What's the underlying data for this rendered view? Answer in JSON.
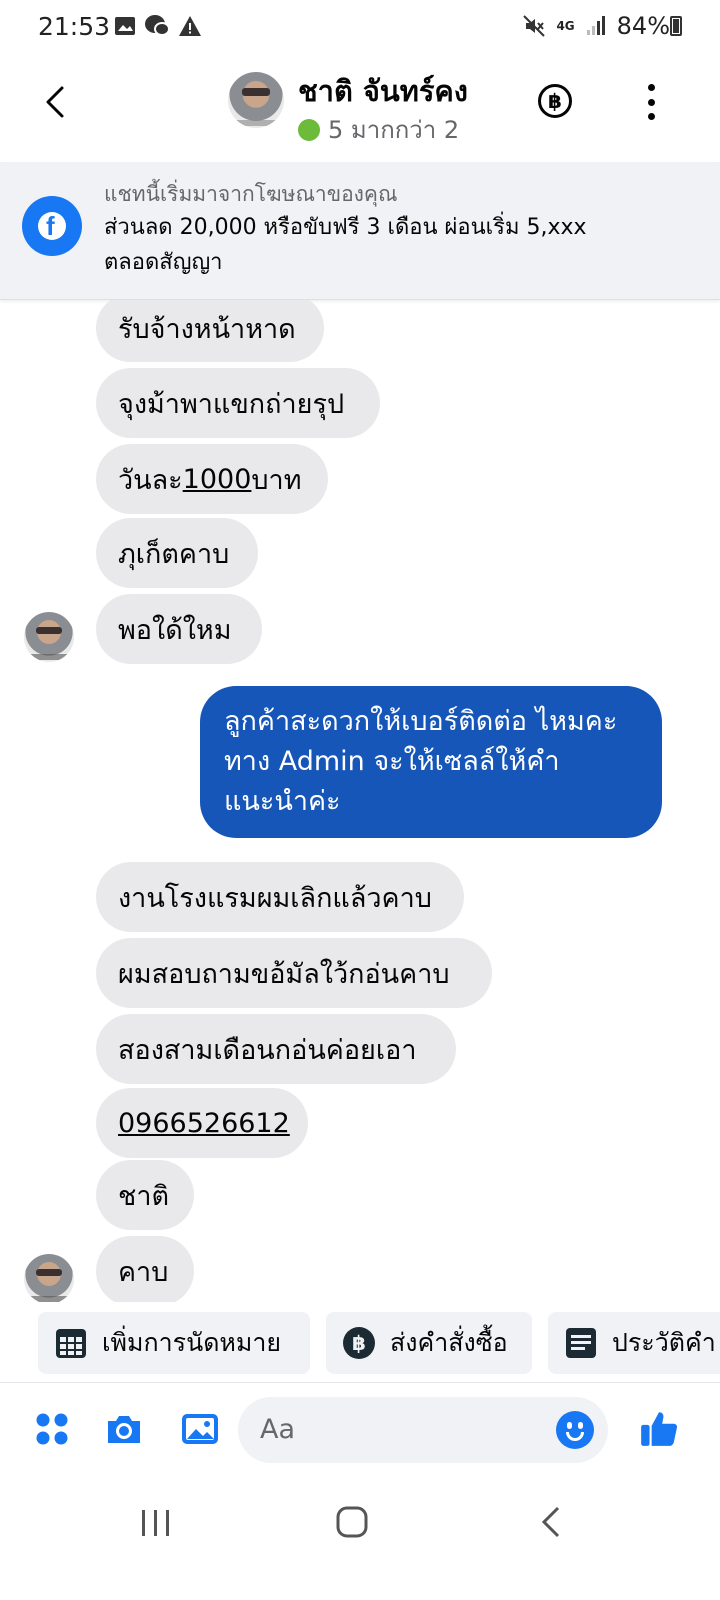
{
  "status_bar": {
    "time": "21:53",
    "battery": "84%",
    "network": "4G"
  },
  "header": {
    "contact_name": "ชาติ จันทร์คง",
    "presence_text": "5 มากกว่า 2",
    "presence_color": "#6dbb3a",
    "baht_symbol": "฿"
  },
  "ad_banner": {
    "subtitle": "แชทนี้เริ่มมาจากโฆษณาของคุณ",
    "body_line1": "ส่วนลด 20,000 หรือขับฟรี 3 เดือน ผ่อนเริ่ม 5,xxx",
    "body_line2": "ตลอดสัญญา"
  },
  "messages": [
    {
      "from": "contact",
      "text": "รับจ้างหน้าหาด"
    },
    {
      "from": "contact",
      "text": "จุงม้าพาแขกถ่ายรุป"
    },
    {
      "from": "contact",
      "text_pre": "วันละ",
      "text_link": "1000",
      "text_post": "บาท"
    },
    {
      "from": "contact",
      "text": "ภุเก็ตคาบ"
    },
    {
      "from": "contact",
      "text": "พอใด้ใหม"
    },
    {
      "from": "me",
      "text": "ลูกค้าสะดวกให้เบอร์ติดต่อ ไหมคะ ทาง Admin จะให้เซลล์ให้คำแนะนำค่ะ"
    },
    {
      "from": "contact",
      "text": "งานโรงแรมผมเลิกแล้วคาบ"
    },
    {
      "from": "contact",
      "text": "ผมสอบถามขอ้มัลใว้กอ่นคาบ"
    },
    {
      "from": "contact",
      "text": "สองสามเดือนกอ่นค่อยเอา"
    },
    {
      "from": "contact",
      "text": "0966526612",
      "link": true
    },
    {
      "from": "contact",
      "text": "ชาติ"
    },
    {
      "from": "contact",
      "text": "คาบ"
    }
  ],
  "quick_actions": [
    {
      "label": "เพิ่มการนัดหมาย",
      "icon": "calendar-icon"
    },
    {
      "label": "ส่งคำสั่งซื้อ",
      "icon": "baht-icon"
    },
    {
      "label": "ประวัติคำ",
      "icon": "receipt-icon"
    }
  ],
  "composer": {
    "placeholder": "Aa",
    "accent_color": "#1877f2"
  },
  "colors": {
    "outgoing_bubble": "#1656b8",
    "incoming_bubble": "#e9e9eb"
  }
}
